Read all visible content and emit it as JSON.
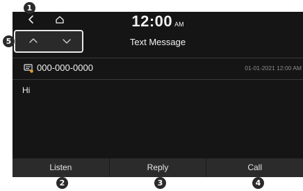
{
  "status_bar": {
    "time": "12:00",
    "ampm": "AM"
  },
  "header": {
    "title": "Text Message"
  },
  "message": {
    "sender": "000-000-0000",
    "date": "01-01-2021 12:00 AM",
    "body": "Hi"
  },
  "actions": {
    "listen": "Listen",
    "reply": "Reply",
    "call": "Call"
  },
  "callouts": {
    "one": "1",
    "two": "2",
    "three": "3",
    "four": "4",
    "five": "5"
  },
  "icons": [
    "back-icon",
    "home-icon",
    "chevron-up-icon",
    "chevron-down-icon",
    "sms-icon"
  ],
  "colors": {
    "screen_background": "#151515",
    "bar_background": "#2b2b2b",
    "text": "#f2f2f2",
    "muted_text": "#8e8e8e"
  }
}
